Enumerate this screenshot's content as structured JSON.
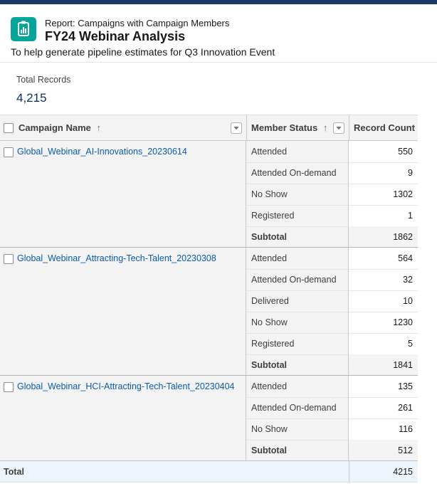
{
  "header": {
    "report_type": "Report: Campaigns with Campaign Members",
    "title": "FY24 Webinar Analysis",
    "description": "To help generate pipeline estimates for Q3 Innovation Event",
    "icon": "report-icon",
    "accent_color": "#06a59a"
  },
  "summary": {
    "label": "Total Records",
    "value": "4,215"
  },
  "table": {
    "columns": {
      "campaign_name": "Campaign Name",
      "member_status": "Member Status",
      "record_count": "Record Count"
    },
    "sort_indicator": "↑",
    "subtotal_label": "Subtotal",
    "groups": [
      {
        "campaign": "Global_Webinar_AI-Innovations_20230614",
        "rows": [
          {
            "status": "Attended",
            "count": "550"
          },
          {
            "status": "Attended On-demand",
            "count": "9"
          },
          {
            "status": "No Show",
            "count": "1302"
          },
          {
            "status": "Registered",
            "count": "1"
          }
        ],
        "subtotal": "1862"
      },
      {
        "campaign": "Global_Webinar_Attracting-Tech-Talent_20230308",
        "rows": [
          {
            "status": "Attended",
            "count": "564"
          },
          {
            "status": "Attended On-demand",
            "count": "32"
          },
          {
            "status": "Delivered",
            "count": "10"
          },
          {
            "status": "No Show",
            "count": "1230"
          },
          {
            "status": "Registered",
            "count": "5"
          }
        ],
        "subtotal": "1841"
      },
      {
        "campaign": "Global_Webinar_HCI-Attracting-Tech-Talent_20230404",
        "rows": [
          {
            "status": "Attended",
            "count": "135"
          },
          {
            "status": "Attended On-demand",
            "count": "261"
          },
          {
            "status": "No Show",
            "count": "116"
          }
        ],
        "subtotal": "512"
      }
    ],
    "total_label": "Total",
    "total_value": "4215",
    "link_color": "#0b5cab"
  }
}
